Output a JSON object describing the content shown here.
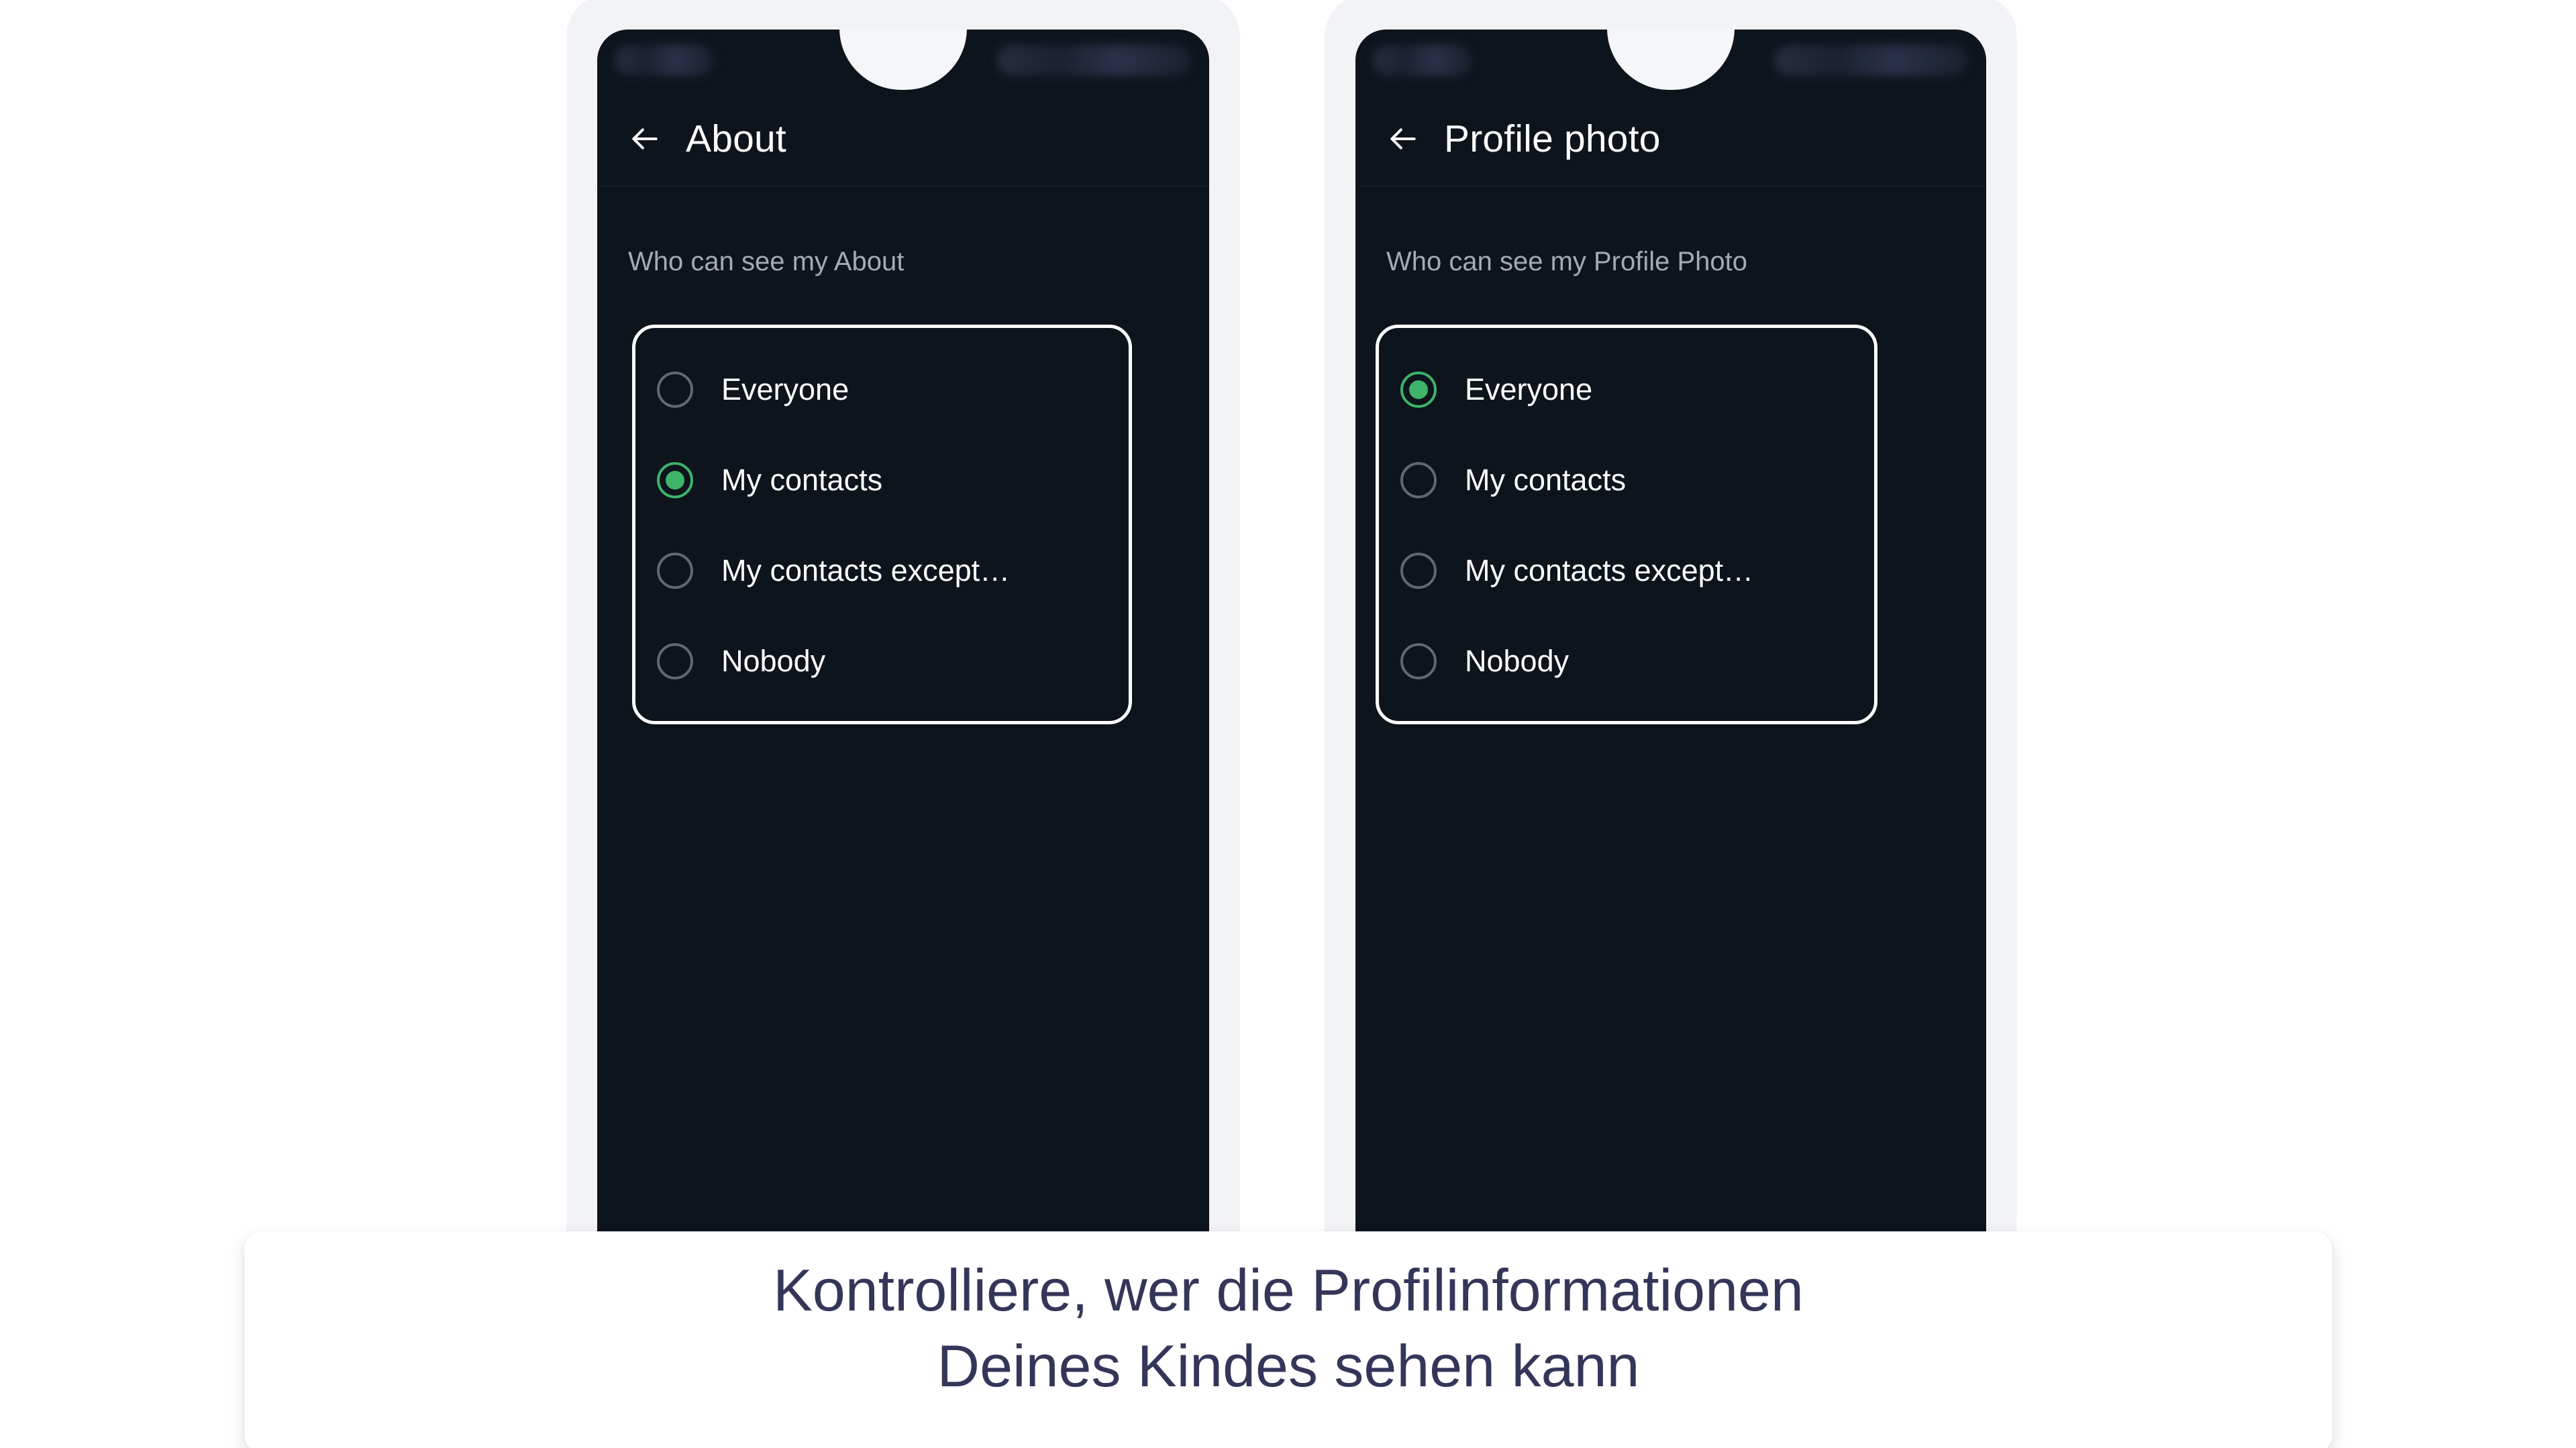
{
  "caption": {
    "line1": "Kontrolliere, wer die Profilinformationen",
    "line2": "Deines Kindes sehen kann",
    "text_color": "#343659"
  },
  "theme": {
    "screen_background": "#0d141c",
    "phone_bezel": "#f2f3f6",
    "accent_green": "#3eb36a",
    "radio_unselected": "#5f6874",
    "section_label_color": "#a5abb6",
    "highlight_border": "#ffffff",
    "page_background": "#ffffff"
  },
  "phones": [
    {
      "id": "about-screen",
      "back_icon": "arrow-left-icon",
      "title": "About",
      "section_label": "Who can see my About",
      "options": [
        {
          "label": "Everyone",
          "selected": false
        },
        {
          "label": "My contacts",
          "selected": true
        },
        {
          "label": "My contacts except…",
          "selected": false
        },
        {
          "label": "Nobody",
          "selected": false
        }
      ]
    },
    {
      "id": "profile-photo-screen",
      "back_icon": "arrow-left-icon",
      "title": "Profile photo",
      "section_label": "Who can see my Profile Photo",
      "options": [
        {
          "label": "Everyone",
          "selected": true
        },
        {
          "label": "My contacts",
          "selected": false
        },
        {
          "label": "My contacts except…",
          "selected": false
        },
        {
          "label": "Nobody",
          "selected": false
        }
      ]
    }
  ]
}
